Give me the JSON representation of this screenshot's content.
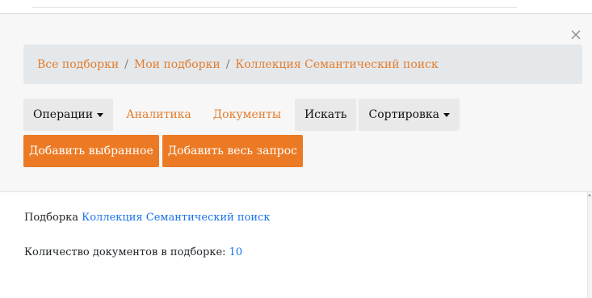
{
  "modal": {
    "close_glyph": "×"
  },
  "breadcrumb": {
    "items": [
      {
        "label": "Все подборки"
      },
      {
        "label": "Мои подборки"
      },
      {
        "label": "Коллекция Семантический поиск"
      }
    ],
    "separator": "/"
  },
  "toolbar": {
    "operations_label": "Операции",
    "analytics_label": "Аналитика",
    "documents_label": "Документы",
    "search_label": "Искать",
    "sort_label": "Сортировка"
  },
  "actions": {
    "add_selected_label": "Добавить выбранное",
    "add_query_label": "Добавить весь запрос"
  },
  "content": {
    "collection_prefix": "Подборка",
    "collection_name": "Коллекция Семантический поиск",
    "count_label": "Количество документов в подборке:",
    "count_value": "10"
  },
  "colors": {
    "accent": "#ec7a24",
    "link_orange": "#e27c2c",
    "link_blue": "#1a73e8",
    "panel_bg": "#f7f7f7",
    "breadcrumb_bg": "#e5e8eb",
    "button_gray": "#e9e9e9"
  }
}
